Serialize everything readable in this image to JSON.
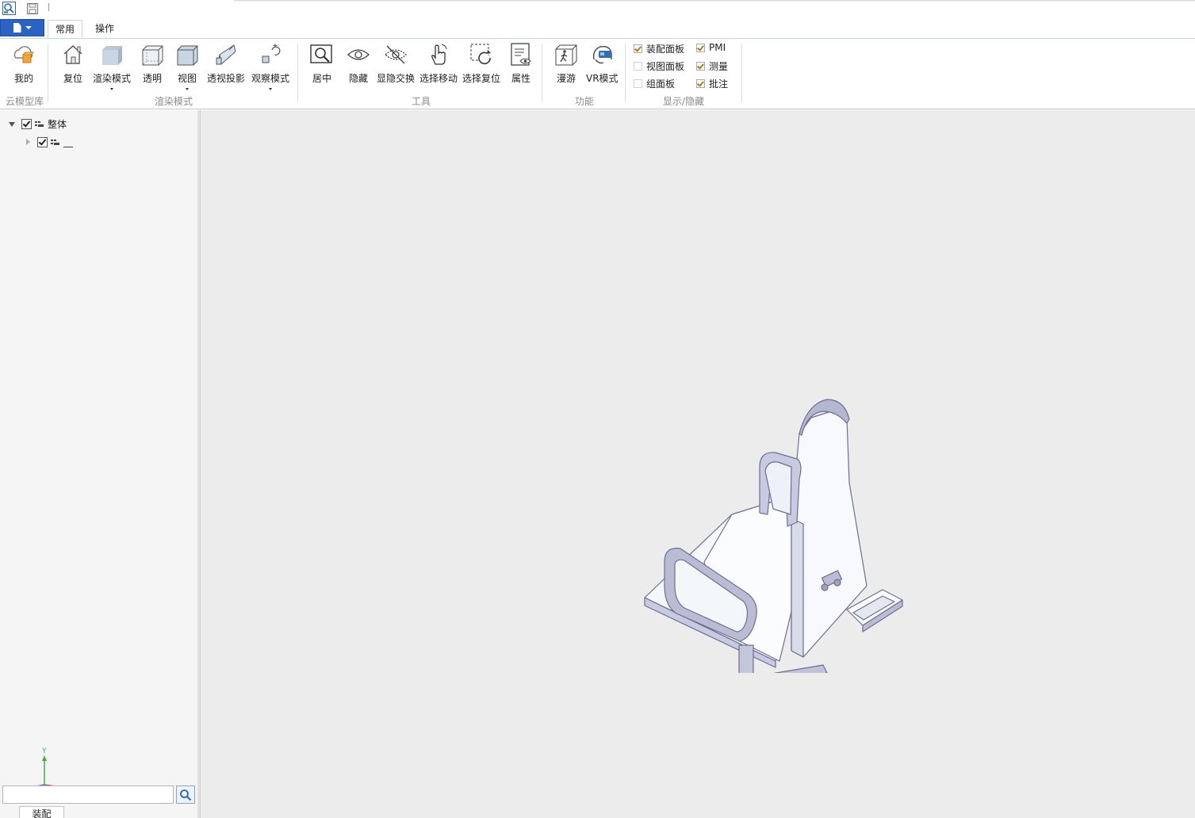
{
  "ribbon_tabs": [
    "常用",
    "操作"
  ],
  "ribbon": {
    "cloud": {
      "my_label": "我的",
      "group_label": "云模型库"
    },
    "render": {
      "reset_label": "复位",
      "render_mode_label": "渲染模式",
      "transparent_label": "透明",
      "view_label": "视图",
      "perspective_label": "透视投影",
      "observe_mode_label": "观察模式",
      "group_label": "渲染模式"
    },
    "tools": {
      "center_label": "居中",
      "hide_label": "隐藏",
      "toggle_visibility_label": "显隐交换",
      "select_move_label": "选择移动",
      "select_reset_label": "选择复位",
      "properties_label": "属性",
      "group_label": "工具"
    },
    "functions": {
      "roam_label": "漫游",
      "vr_label": "VR模式",
      "group_label": "功能"
    },
    "display": {
      "group_label": "显示/隐藏",
      "checkboxes": [
        {
          "label": "装配面板",
          "checked": true
        },
        {
          "label": "视图面板",
          "checked": false
        },
        {
          "label": "组面板",
          "checked": false
        },
        {
          "label": "PMI",
          "checked": true
        },
        {
          "label": "测量",
          "checked": true
        },
        {
          "label": "批注",
          "checked": true
        }
      ]
    }
  },
  "tree": {
    "root_label": "整体",
    "child_label": "__"
  },
  "axis": {
    "y_label": "Y"
  },
  "search": {
    "placeholder": ""
  },
  "bottom_tab": "装配",
  "colors": {
    "accent": "#2b63c5",
    "viewport_bg": "#ececec",
    "panel_bg": "#f5f5f5",
    "model_fill": "#f4f7fb",
    "model_edge": "#8c8fb3"
  }
}
